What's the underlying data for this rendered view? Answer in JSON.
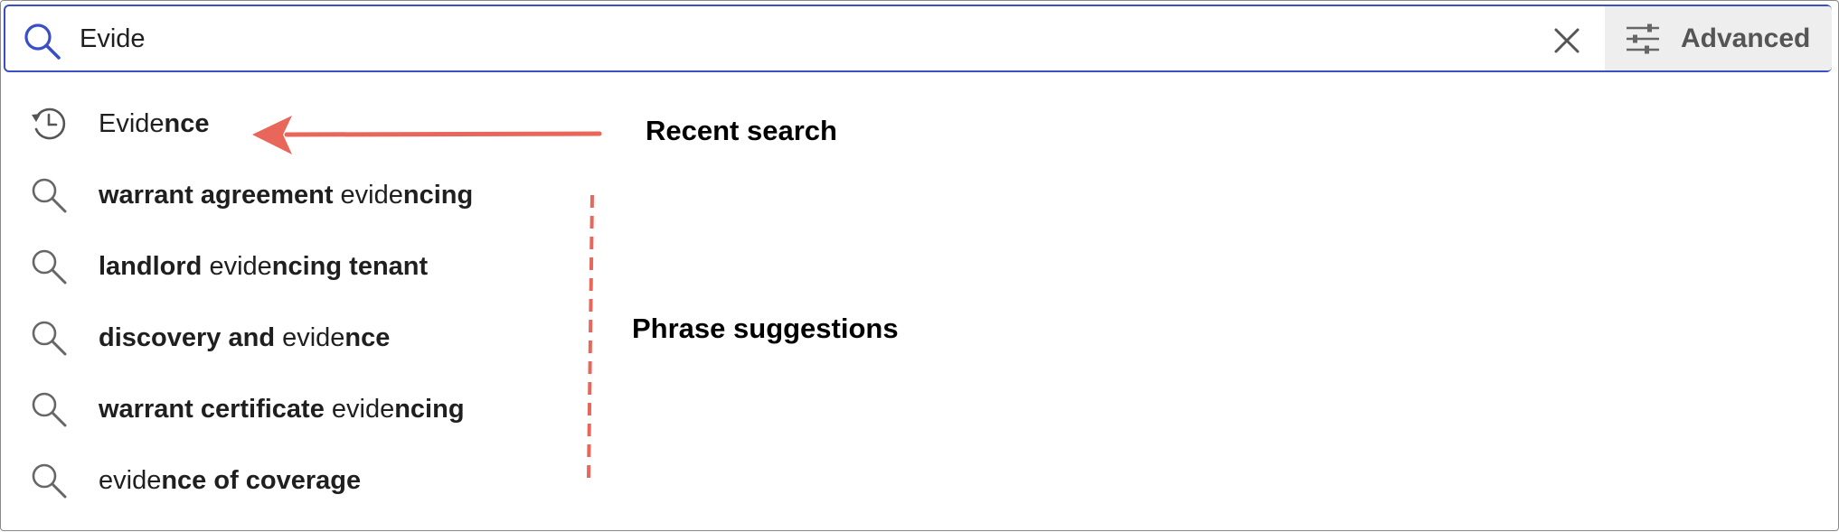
{
  "search": {
    "value": "Evide",
    "icon": "search-icon",
    "clear_icon": "close-icon",
    "advanced_label": "Advanced",
    "advanced_icon": "sliders-icon",
    "accent_color": "#3a4fc4"
  },
  "suggestions": [
    {
      "type": "recent",
      "icon": "history-icon",
      "parts": [
        {
          "text": "Evide",
          "bold": false
        },
        {
          "text": "nce",
          "bold": true
        }
      ]
    },
    {
      "type": "phrase",
      "icon": "search-icon",
      "parts": [
        {
          "text": "warrant agreement",
          "bold": true
        },
        {
          "text": " evide",
          "bold": false
        },
        {
          "text": "ncing",
          "bold": true
        }
      ]
    },
    {
      "type": "phrase",
      "icon": "search-icon",
      "parts": [
        {
          "text": "landlord",
          "bold": true
        },
        {
          "text": " evide",
          "bold": false
        },
        {
          "text": "ncing tenant",
          "bold": true
        }
      ]
    },
    {
      "type": "phrase",
      "icon": "search-icon",
      "parts": [
        {
          "text": "discovery and",
          "bold": true
        },
        {
          "text": " evide",
          "bold": false
        },
        {
          "text": "nce",
          "bold": true
        }
      ]
    },
    {
      "type": "phrase",
      "icon": "search-icon",
      "parts": [
        {
          "text": "warrant certificate",
          "bold": true
        },
        {
          "text": " evide",
          "bold": false
        },
        {
          "text": "ncing",
          "bold": true
        }
      ]
    },
    {
      "type": "phrase",
      "icon": "search-icon",
      "parts": [
        {
          "text": "evide",
          "bold": false
        },
        {
          "text": "nce of coverage",
          "bold": true
        }
      ]
    }
  ],
  "annotations": {
    "recent_label": "Recent search",
    "phrase_label": "Phrase suggestions",
    "arrow_color": "#e8665a"
  }
}
